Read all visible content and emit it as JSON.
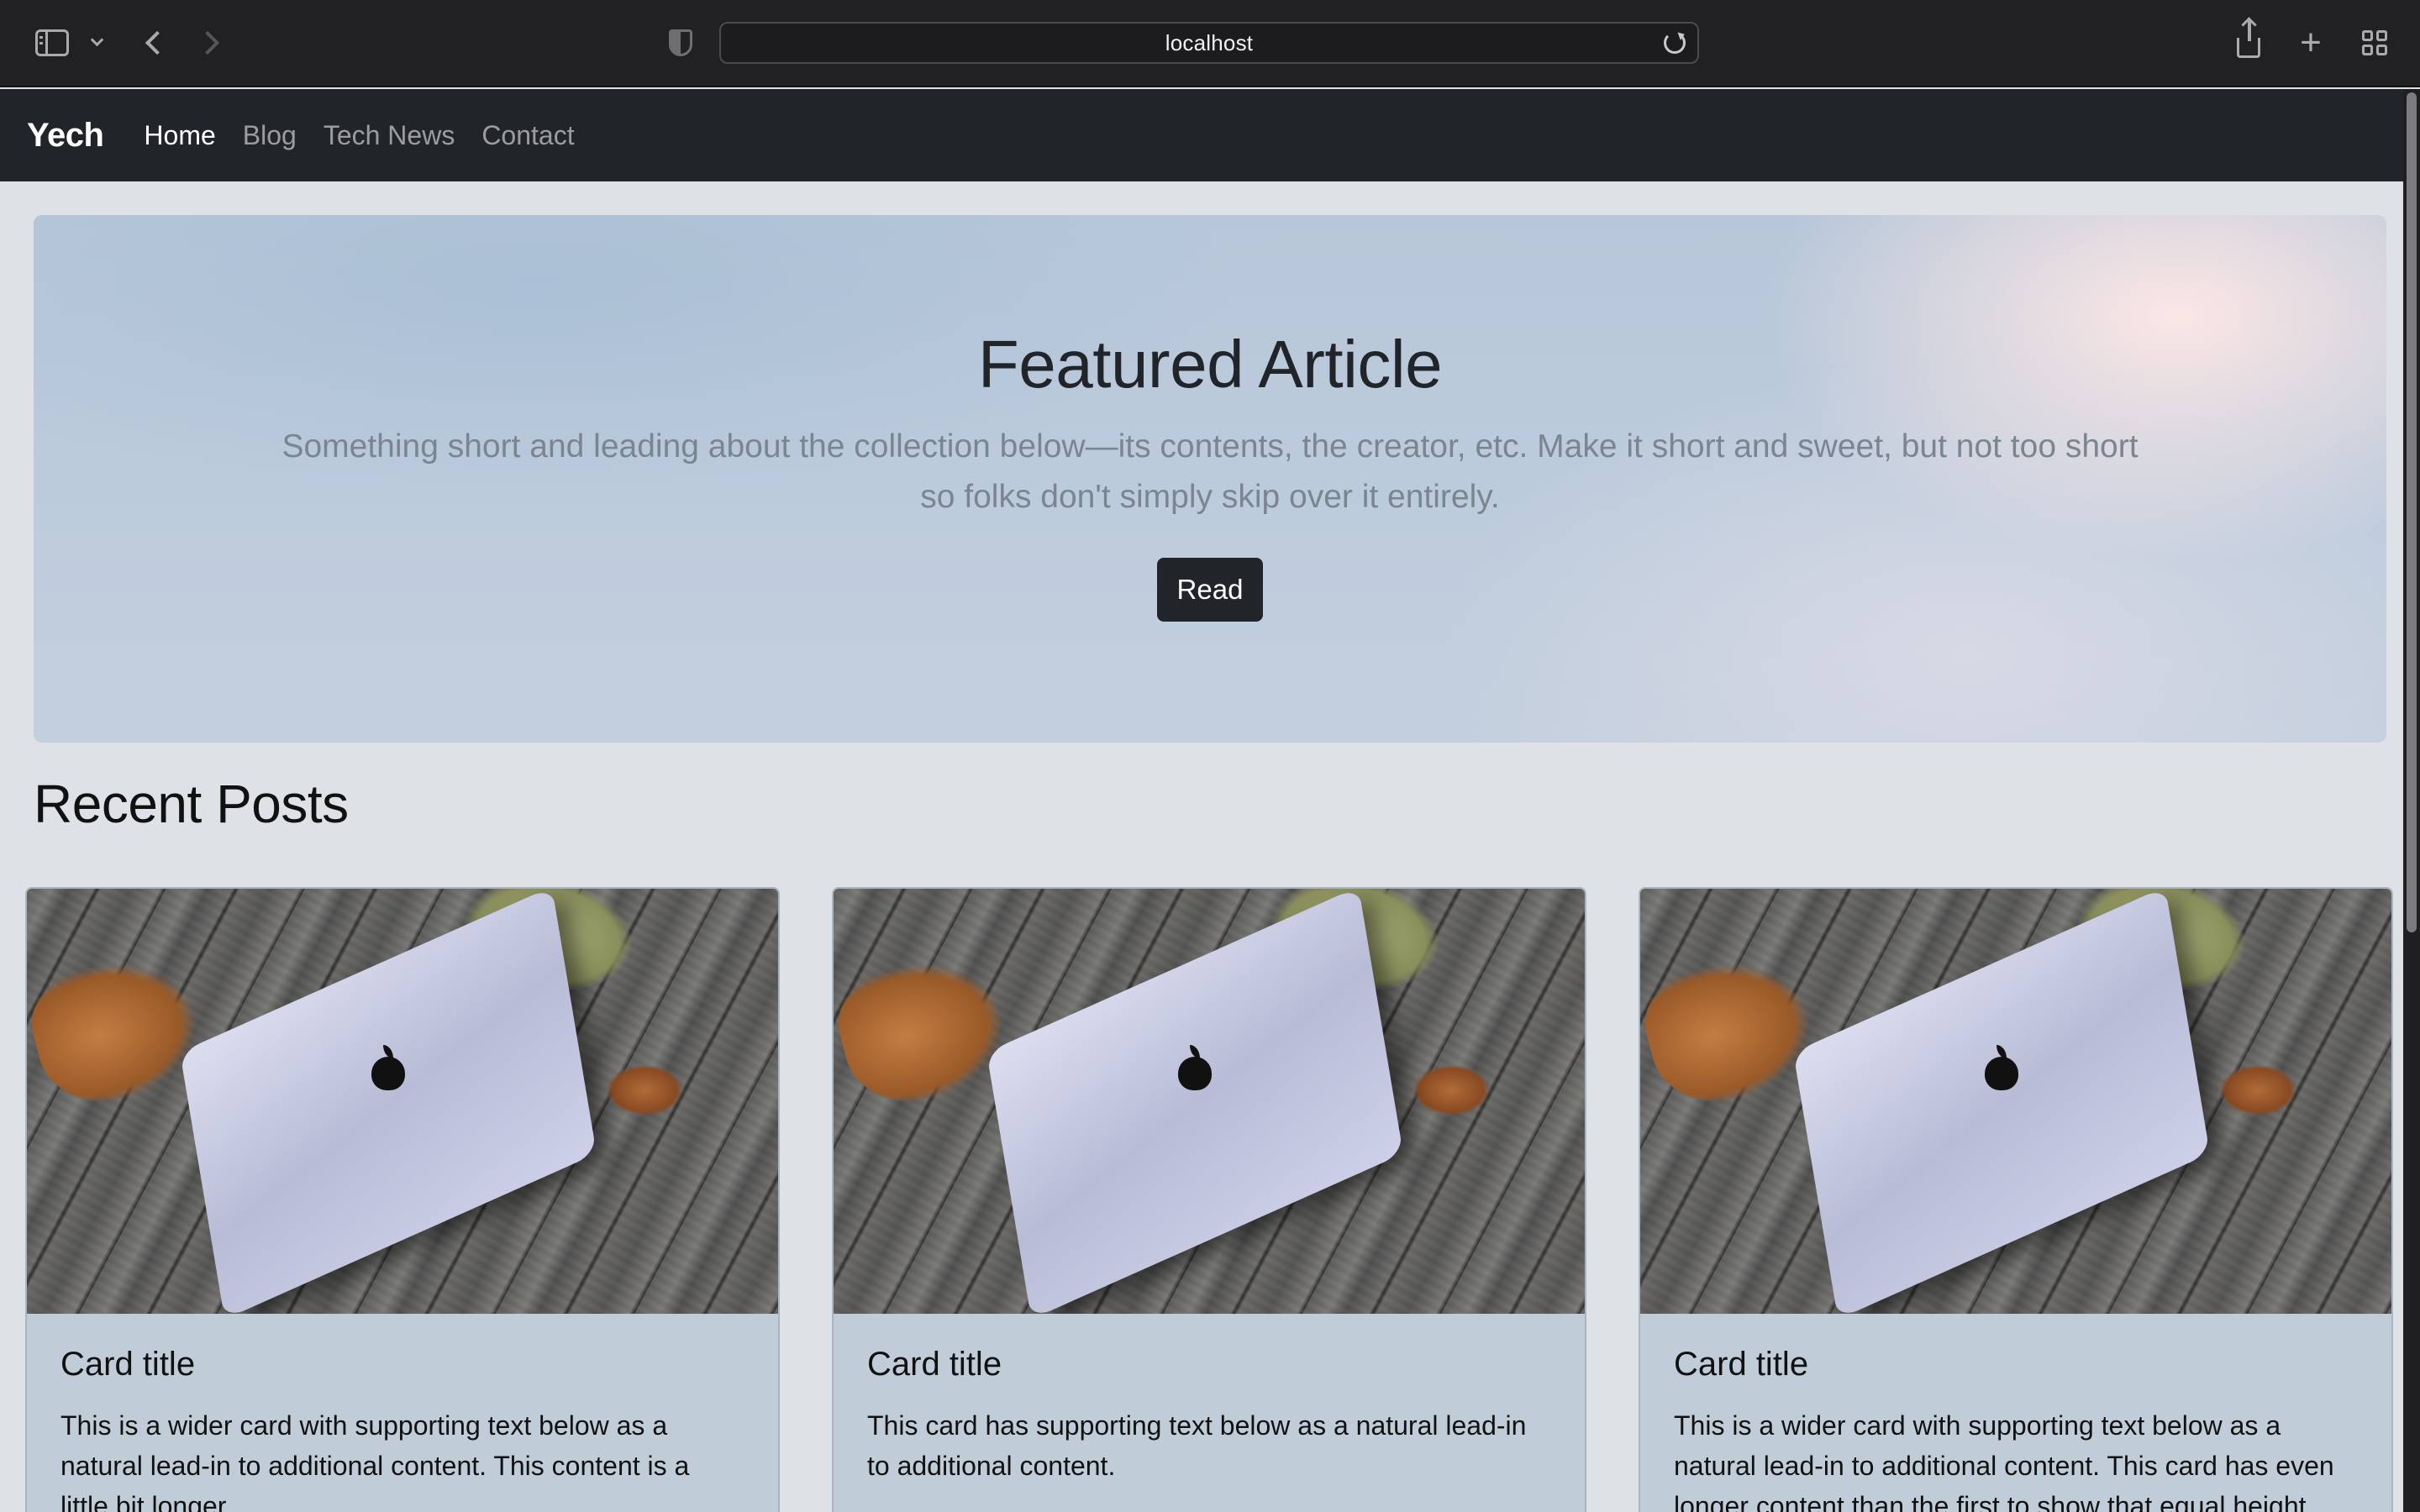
{
  "browser": {
    "url": "localhost"
  },
  "navbar": {
    "brand": "Yech",
    "links": [
      {
        "label": "Home",
        "active": true
      },
      {
        "label": "Blog",
        "active": false
      },
      {
        "label": "Tech News",
        "active": false
      },
      {
        "label": "Contact",
        "active": false
      }
    ]
  },
  "hero": {
    "title": "Featured Article",
    "text": "Something short and leading about the collection below—its contents, the creator, etc. Make it short and sweet, but not too short so folks don't simply skip over it entirely.",
    "button": "Read"
  },
  "recent": {
    "title": "Recent Posts",
    "cards": [
      {
        "title": "Card title",
        "text": "This is a wider card with supporting text below as a natural lead-in to additional content. This content is a little bit longer."
      },
      {
        "title": "Card title",
        "text": "This card has supporting text below as a natural lead-in to additional content."
      },
      {
        "title": "Card title",
        "text": "This is a wider card with supporting text below as a natural lead-in to additional content. This card has even longer content than the first to show that equal height action."
      }
    ]
  },
  "colors": {
    "navbar_bg": "#212529",
    "page_bg": "#dee2e6",
    "card_bg": "#c0cdd8",
    "button_bg": "#212529"
  }
}
